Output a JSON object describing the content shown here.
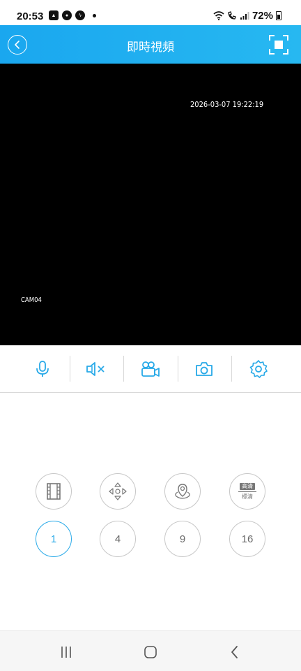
{
  "status_bar": {
    "time": "20:53",
    "battery": "72%",
    "notification_icons": [
      "gallery-icon",
      "line-icon",
      "messenger-icon"
    ],
    "system_icons": [
      "wifi-icon",
      "wifi-call-icon",
      "signal-icon",
      "battery-icon"
    ]
  },
  "header": {
    "title": "即時視頻",
    "back_icon": "chevron-left-icon",
    "fullscreen_icon": "fullscreen-icon"
  },
  "video": {
    "timestamp": "2026-03-07 19:22:19",
    "camera_label": "CAM04"
  },
  "toolbar": {
    "items": [
      "microphone-icon",
      "speaker-mute-icon",
      "video-record-icon",
      "camera-snapshot-icon",
      "settings-gear-icon"
    ]
  },
  "controls": {
    "function_buttons": [
      "playback-film-icon",
      "ptz-direction-icon",
      "fisheye-camera-icon",
      "quality-icon"
    ],
    "quality": {
      "top": "高清",
      "bottom": "標清"
    },
    "split_options": [
      "1",
      "4",
      "9",
      "16"
    ],
    "selected_split": "1"
  },
  "nav": {
    "items": [
      "recent-apps-icon",
      "home-icon",
      "back-icon"
    ]
  },
  "colors": {
    "accent": "#27a9e8",
    "header_gradient_start": "#1aa7ef",
    "video_bg": "#000000"
  }
}
